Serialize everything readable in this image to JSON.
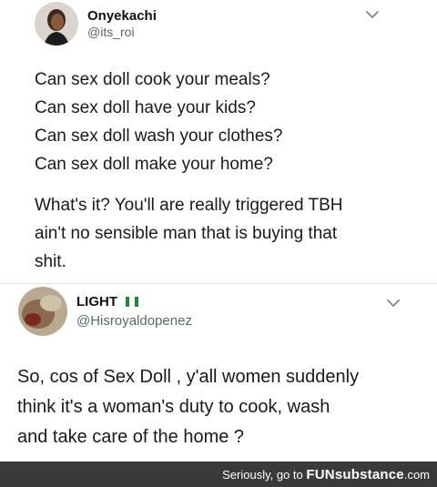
{
  "tweet1": {
    "author_name": "Onyekachi",
    "author_handle": "@its_roi",
    "lines": [
      "Can sex doll cook your meals?",
      "Can sex doll have your kids?",
      "Can sex doll wash your clothes?",
      "Can sex doll make your home?"
    ],
    "paragraph_lines": [
      "What's it? You'll are really triggered TBH",
      "ain't no sensible man that is buying that",
      "shit."
    ]
  },
  "tweet2": {
    "author_name": "LIGHT",
    "author_flag_icon": "nigeria-flag-icon",
    "author_handle": "@Hisroyaldopenez",
    "body_lines": [
      "So, cos of Sex Doll , y'all women suddenly",
      "think it's a woman's duty to cook, wash",
      "and take care of the home ?"
    ]
  },
  "footer": {
    "prefix": "Seriously, go to",
    "brand": "FUNsubstance",
    "domain": ".com"
  },
  "colors": {
    "flag_green": "#1f8a3b",
    "footer_bg": "#3a3a3a",
    "handle": "#5b6670"
  }
}
